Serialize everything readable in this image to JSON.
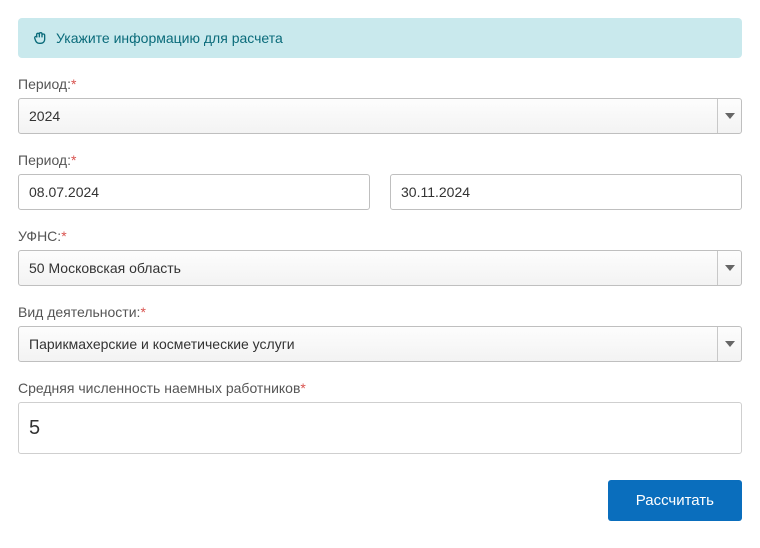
{
  "banner": {
    "text": "Укажите информацию для расчета"
  },
  "fields": {
    "period_year": {
      "label": "Период:",
      "value": "2024"
    },
    "date_from": {
      "value": "08.07.2024"
    },
    "date_to": {
      "value": "30.11.2024"
    },
    "period2_label": "Период:",
    "ufns": {
      "label": "УФНС:",
      "value": "50 Московская область"
    },
    "activity": {
      "label": "Вид деятельности:",
      "value": "Парикмахерские и косметические услуги"
    },
    "employees": {
      "label": "Средняя численность наемных работников",
      "value": "5"
    }
  },
  "buttons": {
    "calculate": "Рассчитать"
  }
}
